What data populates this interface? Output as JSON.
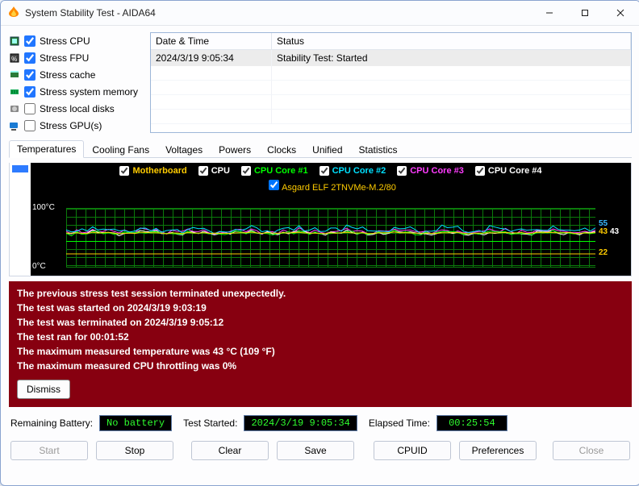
{
  "window": {
    "title": "System Stability Test - AIDA64"
  },
  "stress_options": [
    {
      "label": "Stress CPU",
      "checked": true
    },
    {
      "label": "Stress FPU",
      "checked": true
    },
    {
      "label": "Stress cache",
      "checked": true
    },
    {
      "label": "Stress system memory",
      "checked": true
    },
    {
      "label": "Stress local disks",
      "checked": false
    },
    {
      "label": "Stress GPU(s)",
      "checked": false
    }
  ],
  "log": {
    "columns": [
      "Date & Time",
      "Status"
    ],
    "rows": [
      {
        "datetime": "2024/3/19 9:05:34",
        "status": "Stability Test: Started"
      }
    ]
  },
  "tabs": [
    "Temperatures",
    "Cooling Fans",
    "Voltages",
    "Powers",
    "Clocks",
    "Unified",
    "Statistics"
  ],
  "active_tab": "Temperatures",
  "legend": [
    {
      "name": "Motherboard",
      "color": "#ffcc00",
      "checked": true
    },
    {
      "name": "CPU",
      "color": "#ffffff",
      "checked": true
    },
    {
      "name": "CPU Core #1",
      "color": "#00ff00",
      "checked": true
    },
    {
      "name": "CPU Core #2",
      "color": "#00e0ff",
      "checked": true
    },
    {
      "name": "CPU Core #3",
      "color": "#ff3cff",
      "checked": true
    },
    {
      "name": "CPU Core #4",
      "color": "#ffffff",
      "checked": true
    }
  ],
  "legend_extra": {
    "name": "Asgard ELF 2TNVMe-M.2/80",
    "color": "#ffcc00",
    "checked": true
  },
  "y_axis": {
    "max_label": "100°C",
    "min_label": "0°C"
  },
  "right_values": [
    {
      "text": "55",
      "color": "#3bbaff",
      "top": 12
    },
    {
      "text": "43",
      "color": "#ffcc00",
      "top": 22
    },
    {
      "text": "43",
      "color": "#ffffff",
      "top": 22,
      "offset": 14
    },
    {
      "text": "22",
      "color": "#ffcc00",
      "top": 48
    }
  ],
  "red_messages": [
    "The previous stress test session terminated unexpectedly.",
    "The test was started on 2024/3/19 9:03:19",
    "The test was terminated on 2024/3/19 9:05:12",
    "The test ran for 00:01:52",
    "The maximum measured temperature was 43 °C  (109 °F)",
    "The maximum measured CPU throttling was 0%"
  ],
  "dismiss_label": "Dismiss",
  "status": {
    "battery_label": "Remaining Battery:",
    "battery_value": "No battery",
    "started_label": "Test Started:",
    "started_value": "2024/3/19 9:05:34",
    "elapsed_label": "Elapsed Time:",
    "elapsed_value": "00:25:54"
  },
  "buttons": {
    "start": "Start",
    "stop": "Stop",
    "clear": "Clear",
    "save": "Save",
    "cpuid": "CPUID",
    "preferences": "Preferences",
    "close": "Close"
  },
  "chart_data": {
    "type": "line",
    "title": "Temperatures",
    "ylabel": "°C",
    "ylim": [
      0,
      100
    ],
    "series": [
      {
        "name": "Motherboard",
        "color": "#ffcc00",
        "approx_value": 43
      },
      {
        "name": "CPU",
        "color": "#ffffff",
        "approx_value": 43
      },
      {
        "name": "CPU Core #1",
        "color": "#00ff00",
        "approx_value": 45
      },
      {
        "name": "CPU Core #2",
        "color": "#00e0ff",
        "approx_value": 48
      },
      {
        "name": "CPU Core #3",
        "color": "#ff3cff",
        "approx_value": 47
      },
      {
        "name": "CPU Core #4",
        "color": "#ffffff",
        "approx_value": 46
      },
      {
        "name": "Asgard ELF 2TNVMe-M.2/80",
        "color": "#ffcc00",
        "approx_value": 22
      }
    ],
    "right_readouts": [
      55,
      43,
      43,
      22
    ]
  }
}
